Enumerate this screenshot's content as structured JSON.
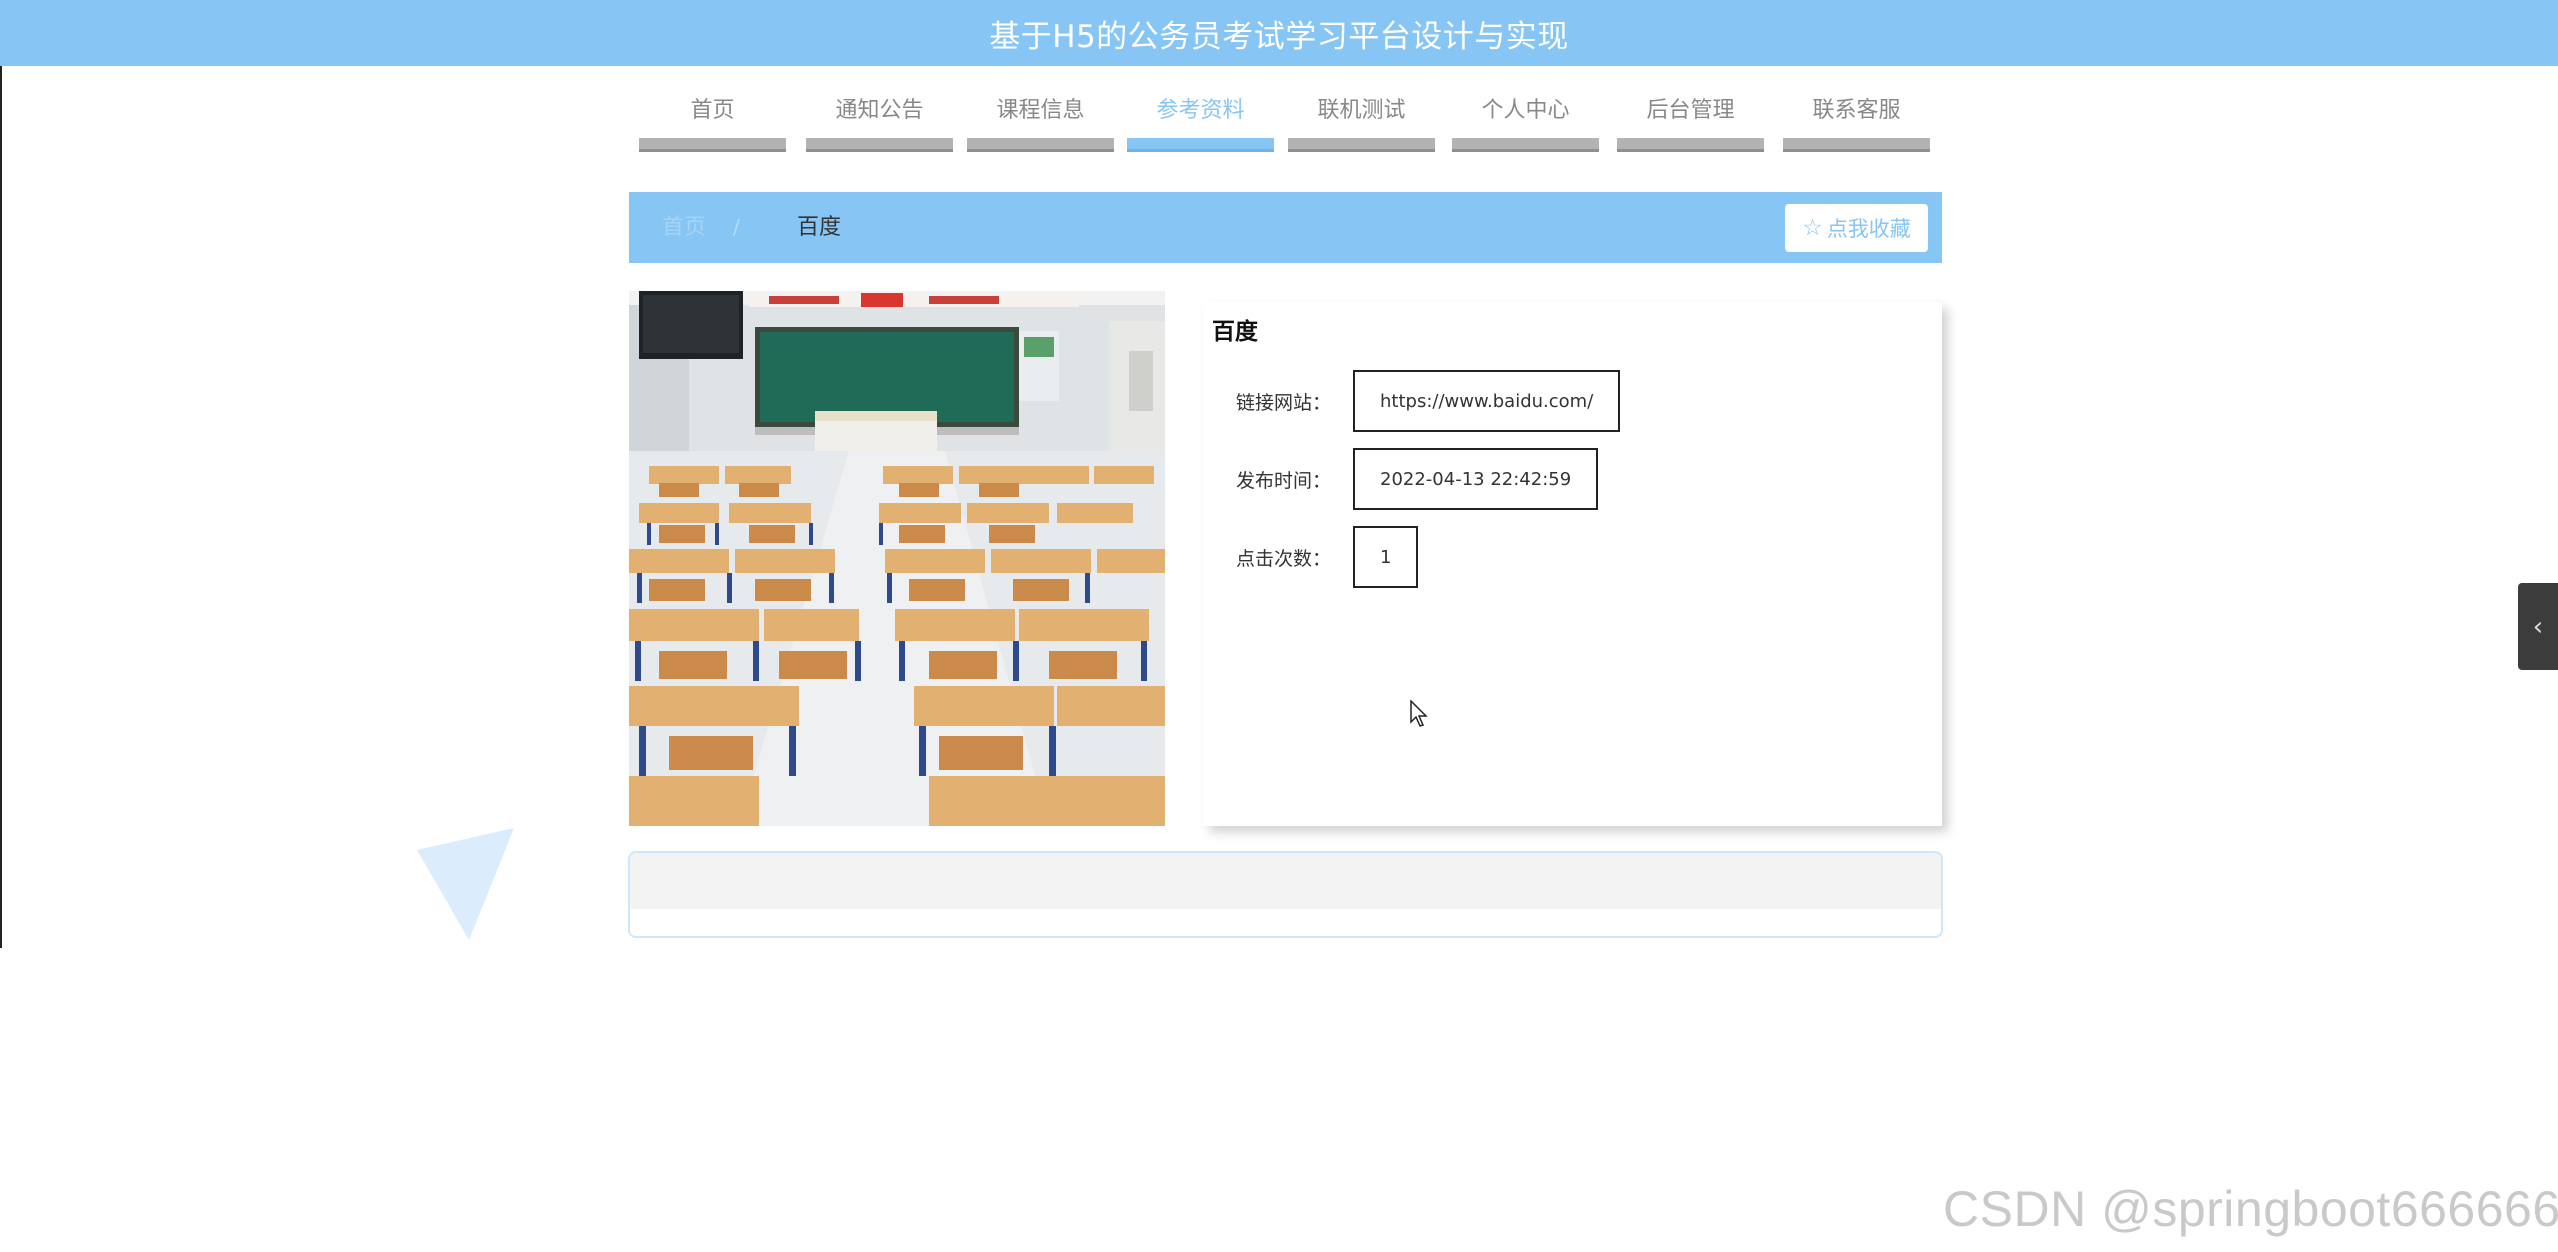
{
  "header": {
    "title": "基于H5的公务员考试学习平台设计与实现"
  },
  "nav": {
    "items": [
      {
        "label": "首页",
        "active": false
      },
      {
        "label": "通知公告",
        "active": false
      },
      {
        "label": "课程信息",
        "active": false
      },
      {
        "label": "参考资料",
        "active": true
      },
      {
        "label": "联机测试",
        "active": false
      },
      {
        "label": "个人中心",
        "active": false
      },
      {
        "label": "后台管理",
        "active": false
      },
      {
        "label": "联系客服",
        "active": false
      }
    ]
  },
  "breadcrumb": {
    "home": "首页",
    "separator": "/",
    "current": "百度"
  },
  "favorite": {
    "icon": "star-outline-icon",
    "label": "点我收藏"
  },
  "detail": {
    "title": "百度",
    "fields": [
      {
        "label": "链接网站：",
        "value": "https://www.baidu.com/"
      },
      {
        "label": "发布时间：",
        "value": "2022-04-13 22:42:59"
      },
      {
        "label": "点击次数：",
        "value": "1"
      }
    ]
  },
  "side_toggle": {
    "icon": "chevron-left-icon"
  },
  "watermark": "CSDN @springboot666666",
  "colors": {
    "primary": "#86c5f4",
    "nav_inactive_bar": "#b3b3b3",
    "panel_border": "#cfe7fb"
  }
}
